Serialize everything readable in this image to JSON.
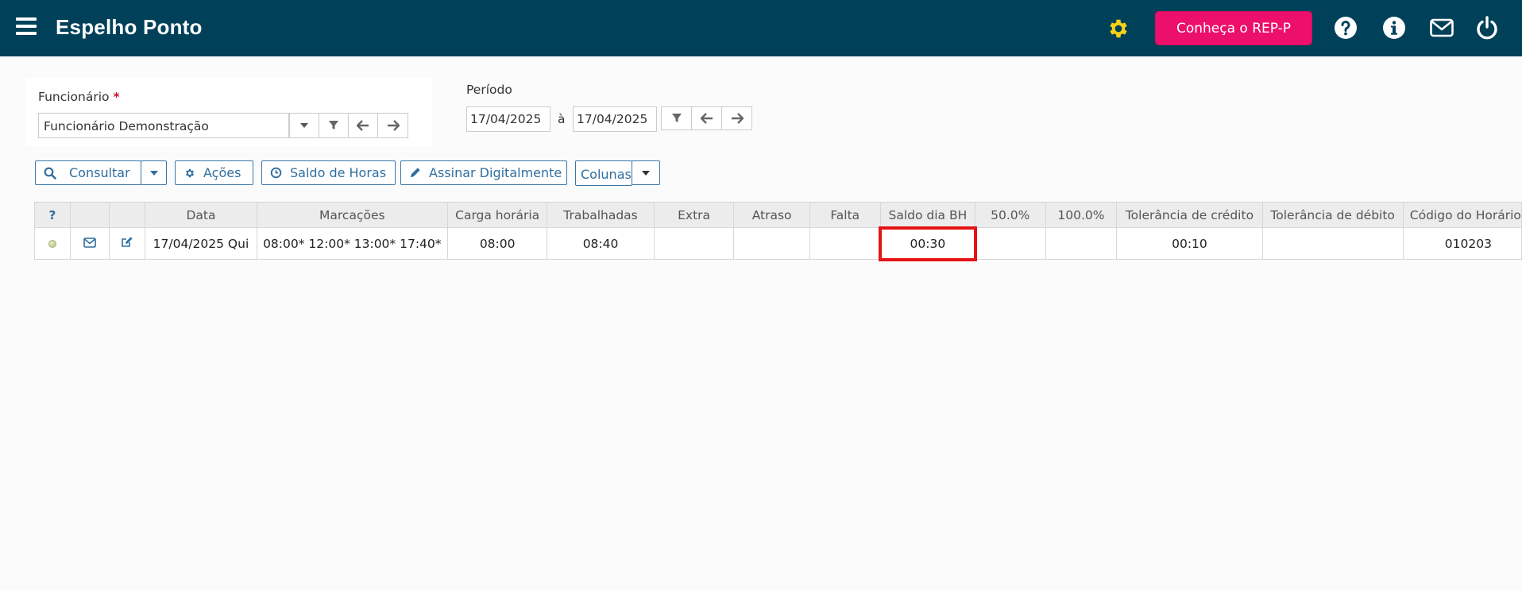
{
  "header": {
    "title": "Espelho Ponto",
    "rep_button": "Conheça o REP-P",
    "accent": "#004159",
    "rep_color": "#ec0f6b"
  },
  "filters": {
    "employee_label": "Funcionário",
    "required_mark": "*",
    "employee_value": "Funcionário Demonstração",
    "period_label": "Período",
    "date_from": "17/04/2025",
    "date_sep": "à",
    "date_to": "17/04/2025"
  },
  "toolbar": {
    "consultar": "Consultar",
    "acoes": "Ações",
    "saldo": "Saldo de Horas",
    "assinar": "Assinar Digitalmente",
    "colunas": "Colunas"
  },
  "table": {
    "help_header": "?",
    "headers": [
      "Data",
      "Marcações",
      "Carga horária",
      "Trabalhadas",
      "Extra",
      "Atraso",
      "Falta",
      "Saldo dia BH",
      "50.0%",
      "100.0%",
      "Tolerância de crédito",
      "Tolerância de débito",
      "Código do Horário"
    ],
    "rows": [
      {
        "cells": [
          "17/04/2025 Qui",
          "08:00* 12:00* 13:00* 17:40*",
          "08:00",
          "08:40",
          "",
          "",
          "",
          "00:30",
          "",
          "",
          "00:10",
          "",
          "010203"
        ]
      }
    ],
    "highlight_color": "#e51313"
  }
}
